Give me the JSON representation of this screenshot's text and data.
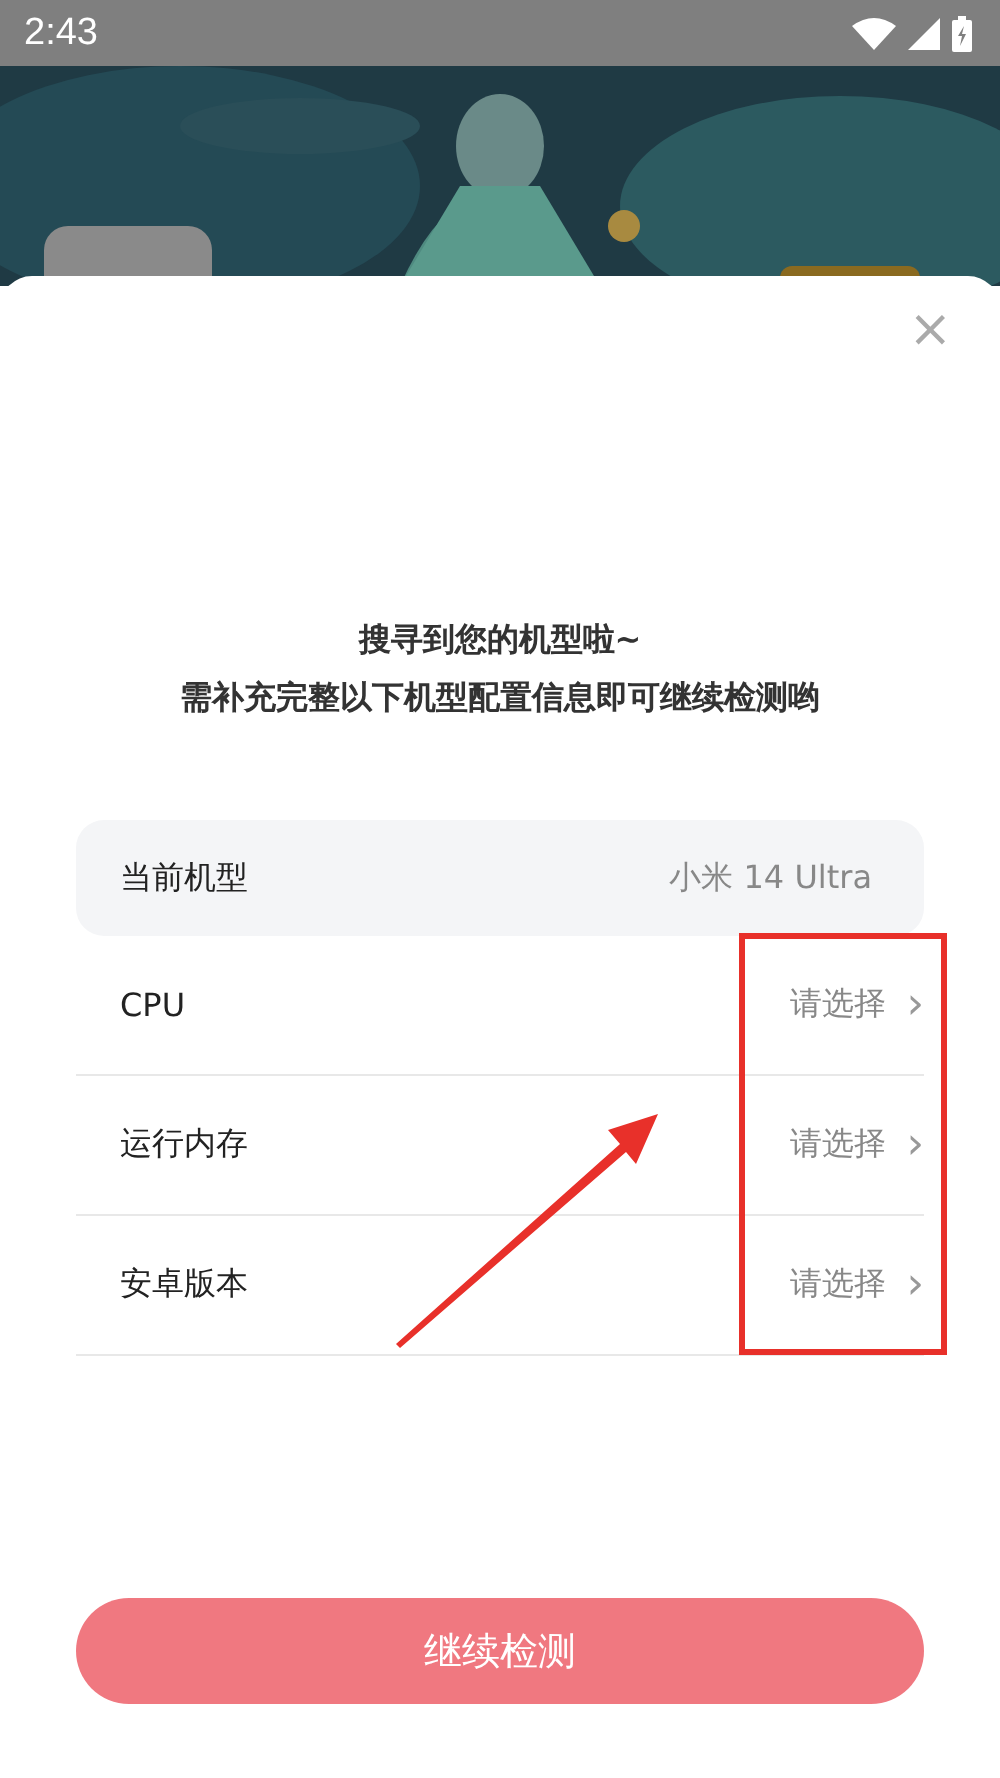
{
  "status_bar": {
    "time": "2:43"
  },
  "sheet": {
    "close": "×",
    "heading": [
      "搜寻到您的机型啦~",
      "需补充完整以下机型配置信息即可继续检测哟"
    ],
    "model": {
      "label": "当前机型",
      "value": "小米 14 Ultra"
    },
    "fields": [
      {
        "label": "CPU",
        "value": "请选择",
        "chevron": "›"
      },
      {
        "label": "运行内存",
        "value": "请选择",
        "chevron": "›"
      },
      {
        "label": "安卓版本",
        "value": "请选择",
        "chevron": "›"
      }
    ],
    "button": "继续检测"
  },
  "annotation": {
    "highlight": true,
    "arrow": true
  }
}
